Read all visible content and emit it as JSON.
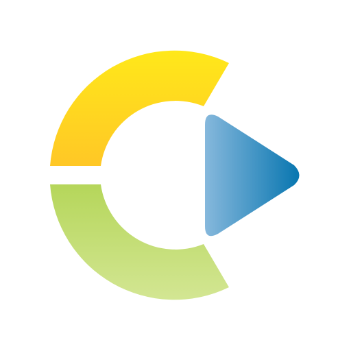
{
  "logo": {
    "icon": "c-play-logo-icon",
    "colors": {
      "top_arc_start": "#FFE81A",
      "top_arc_end": "#FFC726",
      "bottom_arc_start": "#B5D65A",
      "bottom_arc_end": "#D3E693",
      "play_start": "#86B8DC",
      "play_end": "#0876B0",
      "background": "#FFFFFF"
    }
  }
}
